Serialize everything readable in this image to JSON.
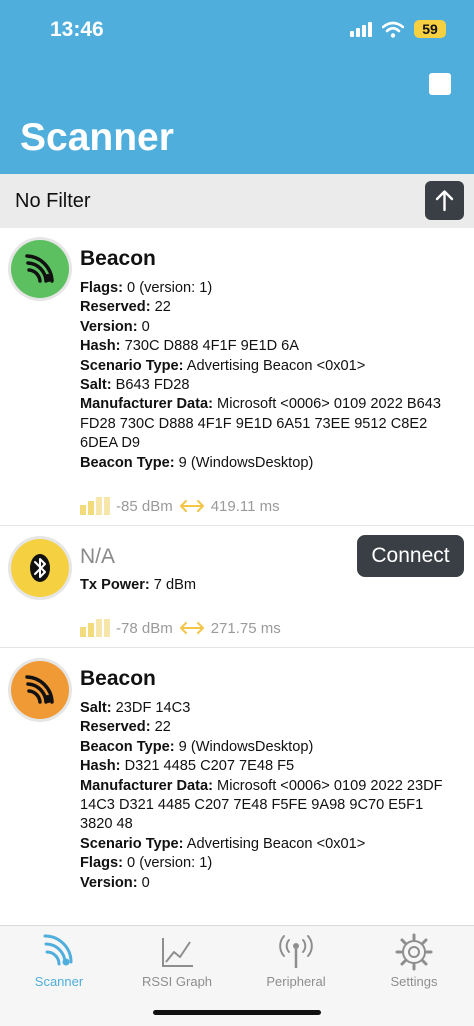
{
  "status": {
    "time": "13:46",
    "battery": "59"
  },
  "header": {
    "title": "Scanner"
  },
  "filter": {
    "label": "No Filter"
  },
  "devices": [
    {
      "name": "Beacon",
      "icon_color": "#5CC061",
      "icon": "broadcast-icon",
      "fields": [
        {
          "label": "Flags:",
          "value": " 0 (version: 1)"
        },
        {
          "label": "Reserved:",
          "value": " 22"
        },
        {
          "label": "Version:",
          "value": " 0"
        },
        {
          "label": "Hash:",
          "value": " 730C D888 4F1F 9E1D 6A"
        },
        {
          "label": "Scenario Type:",
          "value": " Advertising Beacon <0x01>"
        },
        {
          "label": "Salt:",
          "value": " B643 FD28"
        },
        {
          "label": "Manufacturer Data:",
          "value": " Microsoft <0006> 0109 2022 B643 FD28 730C D888 4F1F 9E1D 6A51 73EE 9512 C8E2 6DEA D9"
        },
        {
          "label": "Beacon Type:",
          "value": " 9 (WindowsDesktop)"
        }
      ],
      "rssi": "-85 dBm",
      "interval": "419.11 ms"
    },
    {
      "name": "N/A",
      "icon_color": "#F5D142",
      "icon": "bluetooth-icon",
      "connect_label": "Connect",
      "fields": [
        {
          "label": "Tx Power:",
          "value": " 7 dBm"
        }
      ],
      "rssi": "-78 dBm",
      "interval": "271.75 ms"
    },
    {
      "name": "Beacon",
      "icon_color": "#F09A36",
      "icon": "broadcast-icon",
      "fields": [
        {
          "label": "Salt:",
          "value": " 23DF 14C3"
        },
        {
          "label": "Reserved:",
          "value": " 22"
        },
        {
          "label": "Beacon Type:",
          "value": " 9 (WindowsDesktop)"
        },
        {
          "label": "Hash:",
          "value": " D321 4485 C207 7E48 F5"
        },
        {
          "label": "Manufacturer Data:",
          "value": " Microsoft <0006> 0109 2022 23DF 14C3 D321 4485 C207 7E48 F5FE 9A98 9C70 E5F1 3820 48"
        },
        {
          "label": "Scenario Type:",
          "value": " Advertising Beacon <0x01>"
        },
        {
          "label": "Flags:",
          "value": " 0 (version: 1)"
        },
        {
          "label": "Version:",
          "value": " 0"
        }
      ]
    }
  ],
  "tabs": [
    {
      "label": "Scanner",
      "active": true
    },
    {
      "label": "RSSI Graph",
      "active": false
    },
    {
      "label": "Peripheral",
      "active": false
    },
    {
      "label": "Settings",
      "active": false
    }
  ],
  "colors": {
    "accent": "#4FAEDB",
    "dark_button": "#3A3F45"
  }
}
